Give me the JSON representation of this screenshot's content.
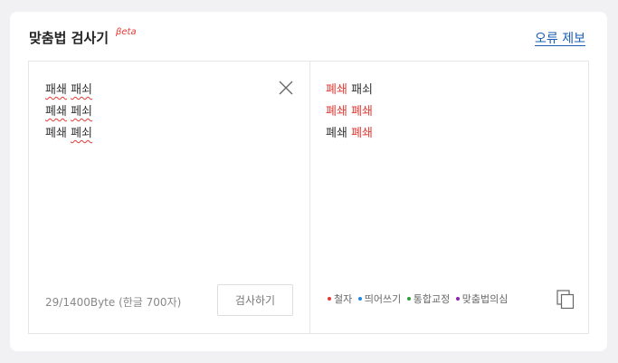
{
  "header": {
    "title": "맞춤법 검사기",
    "beta": "βeta",
    "report_link": "오류 제보"
  },
  "input": {
    "lines": [
      [
        "패쇄",
        "패쇠"
      ],
      [
        "폐쇄",
        "페쇠"
      ],
      [
        "폐쇄",
        "폐쇠"
      ]
    ],
    "byte_count": "29/1400Byte (한글 700자)",
    "check_button": "검사하기"
  },
  "result": {
    "lines": [
      [
        "폐쇄",
        "패쇠"
      ],
      [
        "폐쇄",
        "폐쇄"
      ],
      [
        "폐쇄",
        "폐쇄"
      ]
    ]
  },
  "legend": [
    {
      "label": "철자",
      "color": "#e53935"
    },
    {
      "label": "띄어쓰기",
      "color": "#1e88e5"
    },
    {
      "label": "통합교정",
      "color": "#2e9e3e"
    },
    {
      "label": "맞춤법의심",
      "color": "#8e24aa"
    }
  ],
  "icons": {
    "clear": "close-icon",
    "copy": "copy-icon"
  }
}
